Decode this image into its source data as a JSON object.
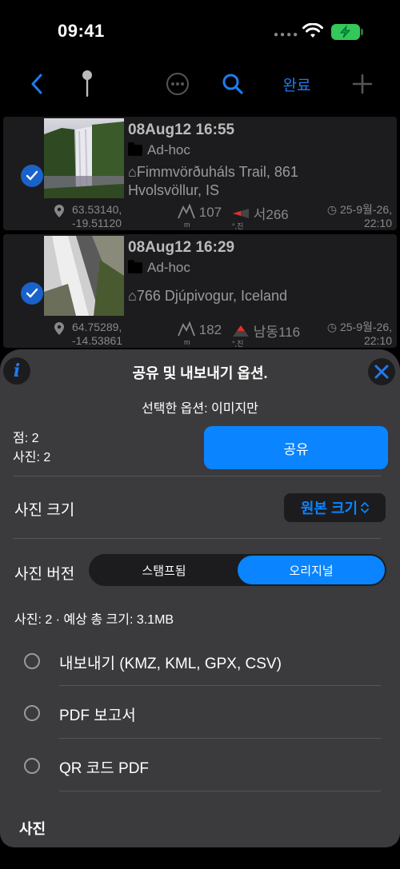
{
  "status_bar": {
    "time": "09:41"
  },
  "toolbar": {
    "back_icon": "chevron-left-icon",
    "pin_icon": "pin-icon",
    "more_icon": "ellipsis-circle-icon",
    "search_icon": "search-icon",
    "done_label": "완료",
    "add_icon": "plus-icon"
  },
  "rows": [
    {
      "title": "08Aug12 16:55",
      "folder": "Ad-hoc",
      "place_line1": "⌂Fimmvörðuháls Trail, 861",
      "place_line2": "Hvolsvöllur, IS",
      "lat": "63.53140,",
      "lon": "-19.51120",
      "altitude": "107",
      "alt_unit": "m",
      "direction": "서266",
      "dir_unit": "°,진",
      "date_line1": "◷ 25-9월-26,",
      "date_line2": "22:10"
    },
    {
      "title": "08Aug12 16:29",
      "folder": "Ad-hoc",
      "place_line1": "⌂766 Djúpivogur, Iceland",
      "place_line2": "",
      "lat": "64.75289,",
      "lon": "-14.53861",
      "altitude": "182",
      "alt_unit": "m",
      "direction": "남동116",
      "dir_unit": "°,진",
      "date_line1": "◷ 25-9월-26,",
      "date_line2": "22:10"
    }
  ],
  "sheet": {
    "title": "공유 및 내보내기 옵션.",
    "selected_option": "선택한 옵션: 이미지만",
    "points": "점: 2",
    "photos": "사진: 2",
    "share_label": "공유",
    "photo_size_label": "사진 크기",
    "photo_size_value": "원본 크기",
    "photo_version_label": "사진 버전",
    "segments": [
      "스탬프됨",
      "오리지널"
    ],
    "active_segment": 1,
    "summary": "사진: 2 · 예상 총 크기: 3.1MB",
    "options": [
      "내보내기 (KMZ, KML, GPX, CSV)",
      "PDF 보고서",
      "QR 코드 PDF"
    ],
    "section_header": "사진"
  },
  "colors": {
    "accent": "#0a84ff",
    "sheet_bg": "#3b3b3d",
    "row_bg": "#1c1c1e"
  }
}
